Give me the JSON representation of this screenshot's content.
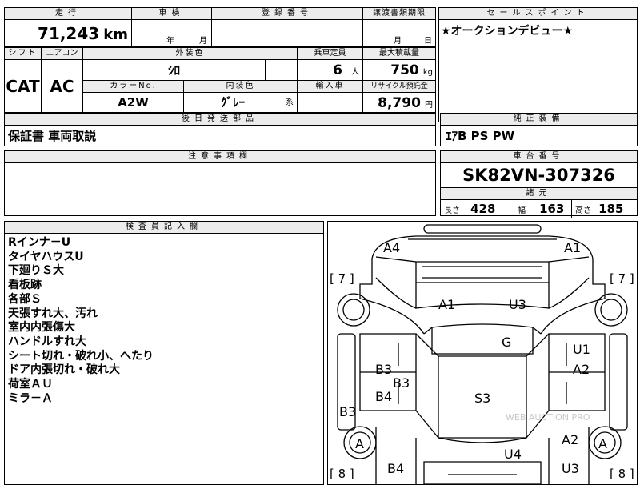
{
  "header": {
    "mileage_label": "走行",
    "mileage_value": "71,243",
    "mileage_unit": "km",
    "inspection_label": "車検",
    "inspection_year": "年",
    "inspection_month": "月",
    "registration_label": "登録番号",
    "transfer_deadline_label": "譲渡書類期限",
    "transfer_month": "月",
    "transfer_day": "日",
    "sales_point_label": "セールスポイント",
    "sales_point_text": "★オークションデビュー★"
  },
  "row2": {
    "shift_label": "シフト",
    "shift_value": "CAT",
    "aircon_label": "エアコン",
    "aircon_value": "AC",
    "exterior_label": "外装色",
    "exterior_value": "ｼﾛ",
    "capacity_label": "乗車定員",
    "capacity_value": "6",
    "capacity_unit": "人",
    "max_load_label": "最大積載量",
    "max_load_value": "750",
    "max_load_unit": "kg",
    "color_no_label": "カラーNo.",
    "color_no_value": "A2W",
    "interior_label": "内装色",
    "interior_value": "ｸﾞﾚｰ",
    "interior_suffix": "系",
    "import_label": "輸入車",
    "recycle_label": "リサイクル預託金",
    "recycle_value": "8,790",
    "recycle_unit": "円"
  },
  "later_parts": {
    "label": "後日発送部品",
    "value": "保証書 車両取説"
  },
  "genuine_equipment": {
    "label": "純正装備",
    "value": "ｴｱB PS PW"
  },
  "caution": {
    "label": "注意事項欄",
    "value": ""
  },
  "chassis": {
    "label": "車台番号",
    "value": "SK82VN-307326",
    "dims_label": "諸元",
    "length_label": "長さ",
    "length_value": "428",
    "width_label": "幅",
    "width_value": "163",
    "height_label": "高さ",
    "height_value": "185"
  },
  "inspector": {
    "label": "検査員記入欄",
    "notes": [
      "Rインナ－U",
      "タイヤハウスU",
      "下廻りＳ大",
      "看板跡",
      "各部Ｓ",
      "天張すれ大、汚れ",
      "室内内張傷大",
      "ハンドルすれ大",
      "シート切れ・破れ小、へたり",
      "ドア内張切れ・破れ大",
      "荷室ＡＵ",
      "ミラ－Ａ"
    ]
  },
  "diagram": {
    "marks": {
      "front_left": "A4",
      "front_right": "A1",
      "bumper_left_num": "[ 7 ]",
      "bumper_right_num": "[ 7 ]",
      "hood_left": "A1",
      "hood_right": "U3",
      "roof": "G",
      "right_door_upper": "U1",
      "right_door_lower": "A2",
      "left_door_upper": "B3",
      "left_door_upper2": "B3",
      "left_door_lower": "B4",
      "left_rocker": "B3",
      "center": "S3",
      "rear_left_wheel": "A",
      "rear_right_wheel": "A",
      "right_rear_quarter": "A2",
      "rear_floor": "U4",
      "rear_left_panel": "B4",
      "rear_right_panel": "U3",
      "rear_left_num": "[ 8 ]",
      "rear_right_num": "[ 8 ]"
    },
    "watermark": "WEB AUCTION PRO"
  }
}
